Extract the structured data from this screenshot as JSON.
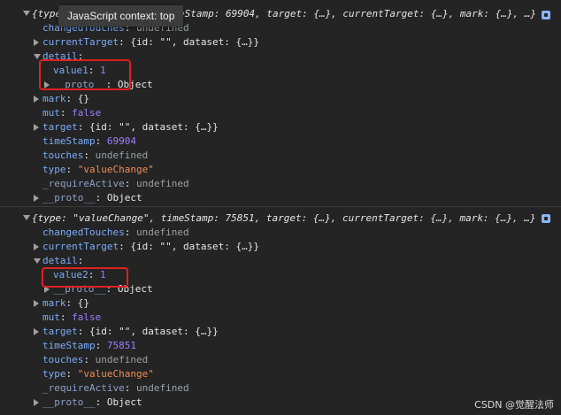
{
  "tooltip": "JavaScript context: top",
  "entries": [
    {
      "summary_prefix": "{type",
      "summary_rest": "eStamp: 69904, target: {…}, currentTarget: {…}, mark: {…}, …}",
      "changed_touches_key": "changedTouches",
      "changed_touches_val": "undefined",
      "current_target_key": "currentTarget",
      "current_target_val": "{id: \"\", dataset: {…}}",
      "detail_key": "detail",
      "value_key": "value1",
      "value_val": "1",
      "detail_proto_key": "__proto__",
      "detail_proto_val": "Object",
      "mark_key": "mark",
      "mark_val": "{}",
      "mut_key": "mut",
      "mut_val": "false",
      "target_key": "target",
      "target_val": "{id: \"\", dataset: {…}}",
      "timestamp_key": "timeStamp",
      "timestamp_val": "69904",
      "touches_key": "touches",
      "touches_val": "undefined",
      "type_key": "type",
      "type_val": "\"valueChange\"",
      "require_key": "_requireActive",
      "require_val": "undefined",
      "proto_key": "__proto__",
      "proto_val": "Object"
    },
    {
      "summary": "{type: \"valueChange\", timeStamp: 75851, target: {…}, currentTarget: {…}, mark: {…}, …}",
      "changed_touches_key": "changedTouches",
      "changed_touches_val": "undefined",
      "current_target_key": "currentTarget",
      "current_target_val": "{id: \"\", dataset: {…}}",
      "detail_key": "detail",
      "value_key": "value2",
      "value_val": "1",
      "detail_proto_key": "__proto__",
      "detail_proto_val": "Object",
      "mark_key": "mark",
      "mark_val": "{}",
      "mut_key": "mut",
      "mut_val": "false",
      "target_key": "target",
      "target_val": "{id: \"\", dataset: {…}}",
      "timestamp_key": "timeStamp",
      "timestamp_val": "75851",
      "touches_key": "touches",
      "touches_val": "undefined",
      "type_key": "type",
      "type_val": "\"valueChange\"",
      "require_key": "_requireActive",
      "require_val": "undefined",
      "proto_key": "__proto__",
      "proto_val": "Object"
    }
  ],
  "watermark": "CSDN @觉醒法师",
  "colors": {
    "background": "#242424",
    "key": "#7cacf8",
    "string": "#f28b54",
    "number": "#9980ff",
    "highlight_box": "#e02020"
  }
}
